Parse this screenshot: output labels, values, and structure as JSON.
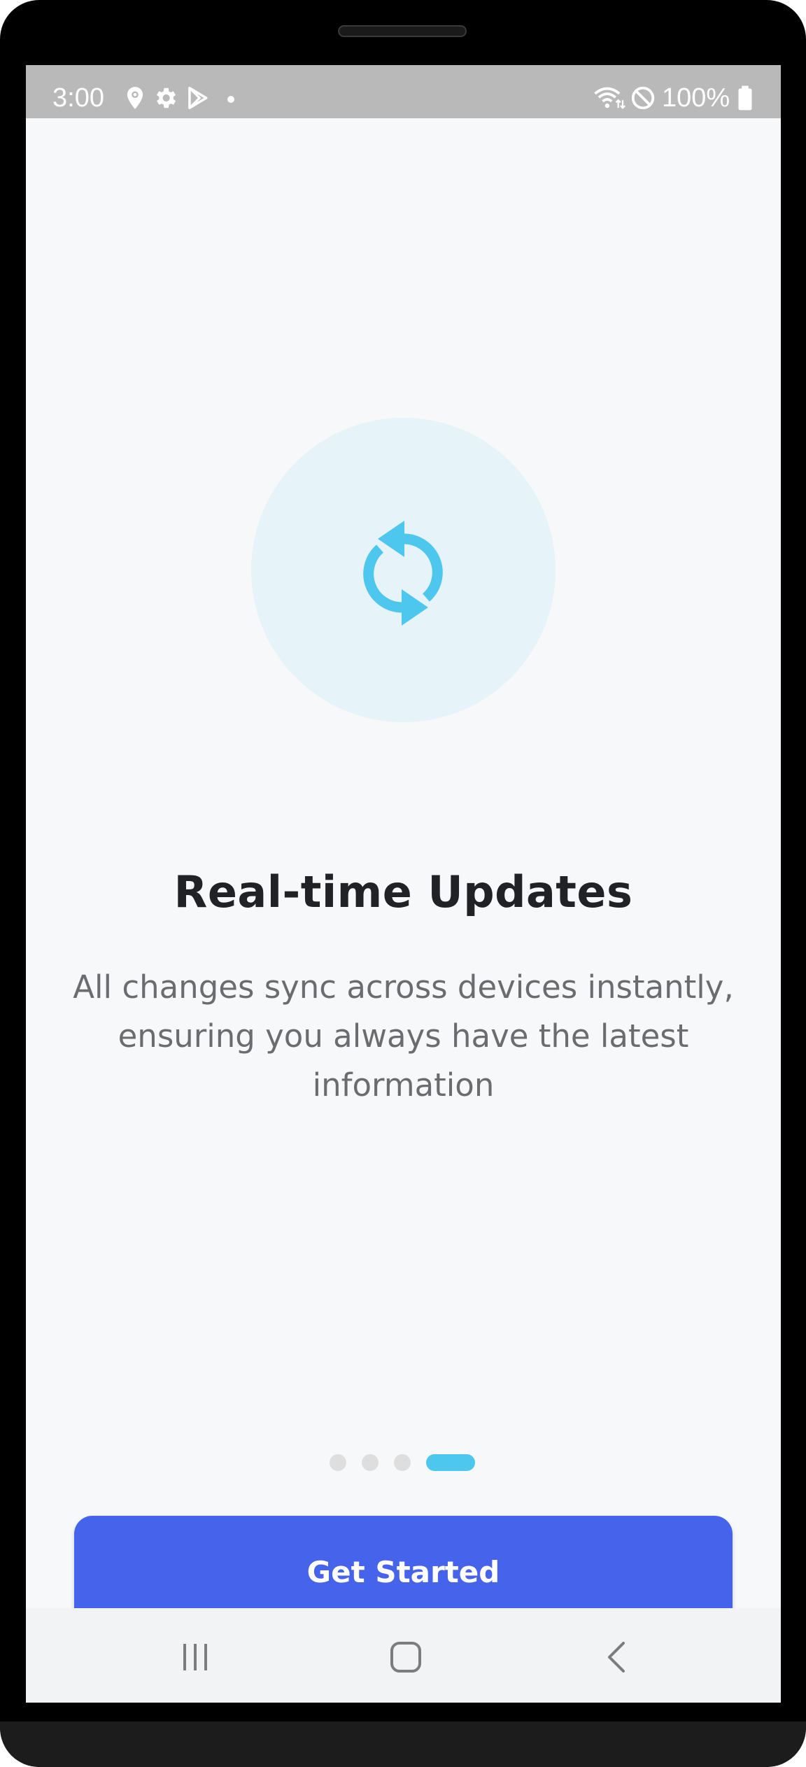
{
  "status_bar": {
    "time": "3:00",
    "battery": "100%",
    "icons": [
      "location-icon",
      "settings-icon",
      "play-store-icon",
      "notification-dot",
      "wifi-icon",
      "do-not-disturb-icon",
      "battery-icon"
    ]
  },
  "onboarding": {
    "illustration_icon": "sync-icon",
    "title": "Real-time Updates",
    "description": "All changes sync across devices instantly, ensuring you always have the latest information",
    "pages_total": 4,
    "current_page": 4,
    "cta_label": "Get Started"
  },
  "navigation_bar": {
    "buttons": [
      "recents-icon",
      "home-icon",
      "back-icon"
    ]
  },
  "colors": {
    "accent": "#4ec7ee",
    "primary_button": "#4663ec",
    "title": "#212226",
    "description": "#6b6c70",
    "background": "#f7f8f9",
    "status_bar": "#b8b9b8"
  }
}
